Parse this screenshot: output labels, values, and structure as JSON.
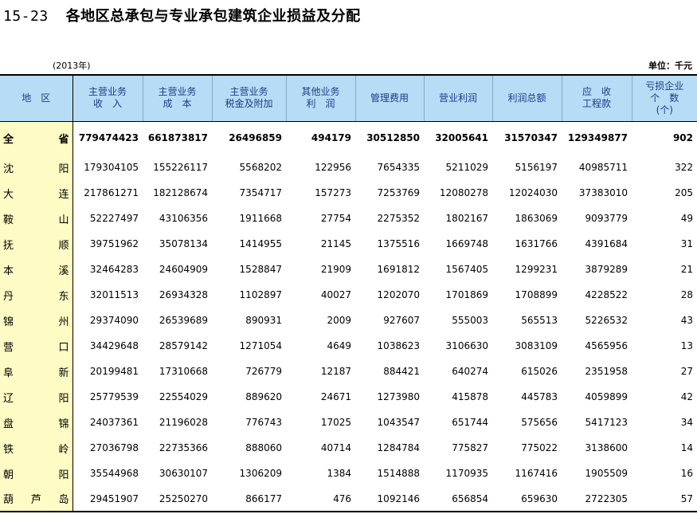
{
  "title": {
    "number": "15-23",
    "text": "各地区总承包与专业承包建筑企业损益及分配"
  },
  "year": "(2013年)",
  "unit": "单位：千元",
  "headers": [
    "地　区",
    "主营业务\n收　入",
    "主营业务\n成　本",
    "主营业务\n税金及附加",
    "其他业务\n利　润",
    "管理费用",
    "营业利润",
    "利润总额",
    "应　收\n工程款",
    "亏损企业\n个　数\n(个)"
  ],
  "rows": [
    {
      "region": [
        "全",
        "省"
      ],
      "values": [
        "779474423",
        "661873817",
        "26496859",
        "494179",
        "30512850",
        "32005641",
        "31570347",
        "129349877",
        "902"
      ]
    },
    {
      "region": [
        "沈",
        "阳"
      ],
      "values": [
        "179304105",
        "155226117",
        "5568202",
        "122956",
        "7654335",
        "5211029",
        "5156197",
        "40985711",
        "322"
      ]
    },
    {
      "region": [
        "大",
        "连"
      ],
      "values": [
        "217861271",
        "182128674",
        "7354717",
        "157273",
        "7253769",
        "12080278",
        "12024030",
        "37383010",
        "205"
      ]
    },
    {
      "region": [
        "鞍",
        "山"
      ],
      "values": [
        "52227497",
        "43106356",
        "1911668",
        "27754",
        "2275352",
        "1802167",
        "1863069",
        "9093779",
        "49"
      ]
    },
    {
      "region": [
        "抚",
        "顺"
      ],
      "values": [
        "39751962",
        "35078134",
        "1414955",
        "21145",
        "1375516",
        "1669748",
        "1631766",
        "4391684",
        "31"
      ]
    },
    {
      "region": [
        "本",
        "溪"
      ],
      "values": [
        "32464283",
        "24604909",
        "1528847",
        "21909",
        "1691812",
        "1567405",
        "1299231",
        "3879289",
        "21"
      ]
    },
    {
      "region": [
        "丹",
        "东"
      ],
      "values": [
        "32011513",
        "26934328",
        "1102897",
        "40027",
        "1202070",
        "1701869",
        "1708899",
        "4228522",
        "28"
      ]
    },
    {
      "region": [
        "锦",
        "州"
      ],
      "values": [
        "29374090",
        "26539689",
        "890931",
        "2009",
        "927607",
        "555003",
        "565513",
        "5226532",
        "43"
      ]
    },
    {
      "region": [
        "营",
        "口"
      ],
      "values": [
        "34429648",
        "28579142",
        "1271054",
        "4649",
        "1038623",
        "3106630",
        "3083109",
        "4565956",
        "13"
      ]
    },
    {
      "region": [
        "阜",
        "新"
      ],
      "values": [
        "20199481",
        "17310668",
        "726779",
        "12187",
        "884421",
        "640274",
        "615026",
        "2351958",
        "27"
      ]
    },
    {
      "region": [
        "辽",
        "阳"
      ],
      "values": [
        "25779539",
        "22554029",
        "889620",
        "24671",
        "1273980",
        "415878",
        "445783",
        "4059899",
        "42"
      ]
    },
    {
      "region": [
        "盘",
        "锦"
      ],
      "values": [
        "24037361",
        "21196028",
        "776743",
        "17025",
        "1043547",
        "651744",
        "575656",
        "5417123",
        "34"
      ]
    },
    {
      "region": [
        "铁",
        "岭"
      ],
      "values": [
        "27036798",
        "22735366",
        "888060",
        "40714",
        "1284784",
        "775827",
        "775022",
        "3138600",
        "14"
      ]
    },
    {
      "region": [
        "朝",
        "阳"
      ],
      "values": [
        "35544968",
        "30630107",
        "1306209",
        "1384",
        "1514888",
        "1170935",
        "1167416",
        "1905509",
        "16"
      ]
    },
    {
      "region": [
        "葫",
        "芦",
        "岛"
      ],
      "values": [
        "29451907",
        "25250270",
        "866177",
        "476",
        "1092146",
        "656854",
        "659630",
        "2722305",
        "57"
      ]
    }
  ]
}
